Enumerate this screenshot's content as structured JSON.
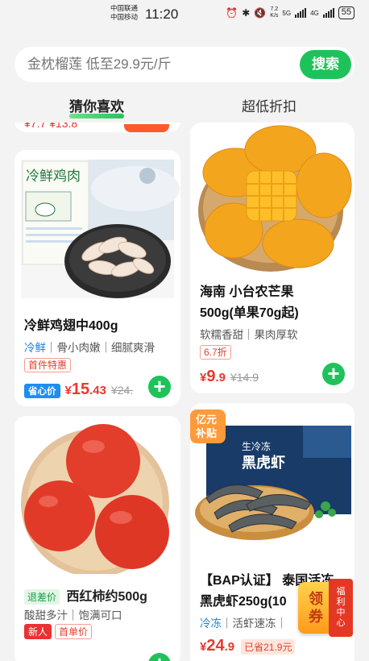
{
  "status_bar": {
    "carrier_1": "中国联通",
    "carrier_2": "中国移动",
    "time": "11:20",
    "speed_value": "7.2",
    "speed_unit": "K/s",
    "net_1": "5G",
    "net_2": "4G",
    "battery": "55"
  },
  "search": {
    "placeholder": "金枕榴莲 低至29.9元/斤",
    "button_label": "搜索"
  },
  "tabs": [
    {
      "label": "猜你喜欢",
      "active": true
    },
    {
      "label": "超低折扣",
      "active": false
    }
  ],
  "products": [
    {
      "id": "chicken",
      "image_label": "冷鲜鸡肉",
      "title": "冷鲜鸡翅中400g",
      "sub_highlight": "冷鲜",
      "sub_rest": "｜骨小肉嫩｜细腻爽滑",
      "tag": "首件特惠",
      "badge": "省心价",
      "price_symbol": "¥",
      "price_int": "15",
      "price_dec": ".43",
      "old_price": "¥24."
    },
    {
      "id": "mango",
      "title_line1": "海南 小台农芒果",
      "title_line2": "500g(单果70g起)",
      "sub": "软糯香甜｜果肉厚软",
      "tag": "6.7折",
      "price_symbol": "¥",
      "price_int": "9",
      "price_dec": ".9",
      "old_price": "¥14.9"
    },
    {
      "id": "tomato",
      "badge": "退差价",
      "title": "西红柿约500g",
      "sub": "酸甜多汁｜饱满可口",
      "tag_1": "新人",
      "tag_2": "首单价"
    },
    {
      "id": "shrimp",
      "subsidy_badge_1": "亿元",
      "subsidy_badge_2": "补贴",
      "package_text_1": "生冷冻",
      "package_text_2": "黑虎虾",
      "title_line1": "【BAP认证】 泰国活冻",
      "title_line2": "黑虎虾250g(10",
      "sub_highlight": "冷冻",
      "sub_rest": "｜活虾速冻｜",
      "price_symbol": "¥",
      "price_int": "24",
      "price_dec": ".9",
      "saved": "已省21.9元"
    }
  ],
  "top_partial": {
    "price_hint": "¥7.7 ¥13.8"
  },
  "floating": {
    "coupon": "领券",
    "welfare": "福利中心"
  },
  "colors": {
    "accent_green": "#1fc25a",
    "price_red": "#e63a2e",
    "link_blue": "#1a7fd6"
  }
}
